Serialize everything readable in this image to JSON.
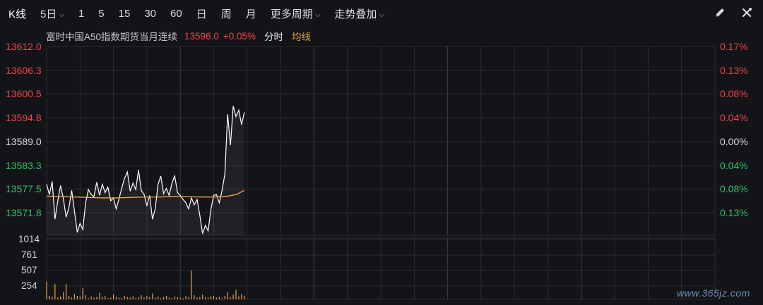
{
  "toolbar": {
    "items": [
      {
        "label": "K线"
      },
      {
        "label": "5日",
        "dropdown": true
      },
      {
        "label": "1"
      },
      {
        "label": "5"
      },
      {
        "label": "15"
      },
      {
        "label": "30"
      },
      {
        "label": "60"
      },
      {
        "label": "日"
      },
      {
        "label": "周"
      },
      {
        "label": "月"
      },
      {
        "label": "更多周期",
        "dropdown": true
      },
      {
        "label": "走势叠加",
        "dropdown": true
      }
    ],
    "tools": [
      "draw-pen-icon",
      "settings-cross-icon"
    ]
  },
  "info": {
    "title": "富时中国A50指数期货当月连续",
    "price": "13596.0",
    "change": "+0.05%",
    "mode": "分时",
    "avg_label": "均线"
  },
  "colors": {
    "up": "#f0444b",
    "down": "#2ec26b",
    "price_line": "#ffffff",
    "avg_line": "#e8a24a",
    "volume": "#e8a24a",
    "grid": "#2a2c31"
  },
  "watermark": "www.365jz.com",
  "chart_data": [
    {
      "type": "line",
      "title": "富时中国A50指数期货当月连续",
      "y_left_ticks": [
        "13612.0",
        "13606.3",
        "13600.5",
        "13594.8",
        "13589.0",
        "13583.3",
        "13577.5",
        "13571.8"
      ],
      "y_right_ticks": [
        "0.17%",
        "0.13%",
        "0.08%",
        "0.04%",
        "0.00%",
        "0.04%",
        "0.08%",
        "0.13%"
      ],
      "ylim": [
        13566.1,
        13612.0
      ],
      "reference_price": 13589.0,
      "x_range": [
        0,
        480
      ],
      "series": [
        {
          "name": "",
          "x": [
            0,
            2,
            4,
            6,
            8,
            10,
            12,
            14,
            16,
            18,
            20,
            22,
            24,
            26,
            28,
            30,
            32,
            34,
            36,
            38,
            40,
            42,
            44,
            46,
            48,
            50,
            52,
            54,
            56,
            58,
            60,
            62,
            64,
            66,
            68,
            70,
            72,
            74,
            76,
            78,
            80,
            82,
            84,
            86,
            88,
            90,
            92,
            94,
            96,
            98,
            100,
            102,
            104,
            106,
            108,
            110,
            112,
            114,
            116,
            118,
            120,
            122,
            124,
            126,
            128,
            130,
            132,
            134,
            136,
            138,
            140,
            142
          ],
          "values": [
            13578.5,
            13576.0,
            13579.2,
            13570.0,
            13574.5,
            13578.2,
            13575.0,
            13570.5,
            13572.8,
            13577.0,
            13572.0,
            13566.8,
            13569.0,
            13567.5,
            13574.0,
            13577.2,
            13576.0,
            13575.5,
            13579.0,
            13575.8,
            13578.5,
            13576.5,
            13577.8,
            13574.5,
            13575.2,
            13572.5,
            13575.0,
            13577.6,
            13580.0,
            13581.5,
            13576.8,
            13578.8,
            13577.2,
            13582.0,
            13577.0,
            13576.0,
            13573.2,
            13575.8,
            13570.0,
            13572.5,
            13578.5,
            13580.5,
            13576.2,
            13577.5,
            13575.8,
            13578.8,
            13580.5,
            13576.5,
            13575.8,
            13574.8,
            13574.0,
            13572.5,
            13575.2,
            13573.5,
            13574.8,
            13571.0,
            13566.5,
            13568.5,
            13567.2,
            13572.5,
            13575.8,
            13576.0,
            13574.0,
            13577.0,
            13581.0,
            13595.5,
            13588.0,
            13597.5,
            13595.0,
            13596.5,
            13593.0,
            13596.0
          ]
        },
        {
          "name": "均线",
          "x": [
            0,
            10,
            20,
            30,
            40,
            50,
            60,
            70,
            80,
            90,
            100,
            110,
            120,
            130,
            136,
            142
          ],
          "values": [
            13575.6,
            13575.5,
            13575.4,
            13575.3,
            13575.2,
            13575.2,
            13575.3,
            13575.4,
            13575.4,
            13575.5,
            13575.5,
            13575.4,
            13575.4,
            13575.6,
            13576.0,
            13577.0
          ]
        }
      ]
    },
    {
      "type": "bar",
      "title": "",
      "y_ticks": [
        "1014",
        "761",
        "507",
        "254"
      ],
      "ylim": [
        0,
        1014
      ],
      "x_range": [
        0,
        480
      ],
      "x": [
        0,
        2,
        4,
        6,
        8,
        10,
        12,
        14,
        16,
        18,
        20,
        22,
        24,
        26,
        28,
        30,
        32,
        34,
        36,
        38,
        40,
        42,
        44,
        46,
        48,
        50,
        52,
        54,
        56,
        58,
        60,
        62,
        64,
        66,
        68,
        70,
        72,
        74,
        76,
        78,
        80,
        82,
        84,
        86,
        88,
        90,
        92,
        94,
        96,
        98,
        100,
        102,
        104,
        106,
        108,
        110,
        112,
        114,
        116,
        118,
        120,
        122,
        124,
        126,
        128,
        130,
        132,
        134,
        136,
        138,
        140,
        142
      ],
      "values": [
        300,
        60,
        40,
        260,
        30,
        50,
        120,
        260,
        60,
        30,
        90,
        60,
        40,
        190,
        70,
        20,
        50,
        30,
        40,
        110,
        40,
        60,
        20,
        30,
        80,
        40,
        30,
        20,
        60,
        40,
        30,
        50,
        20,
        40,
        70,
        30,
        60,
        40,
        100,
        30,
        50,
        20,
        40,
        60,
        30,
        20,
        50,
        40,
        30,
        20,
        60,
        40,
        490,
        70,
        30,
        40,
        80,
        40,
        30,
        50,
        60,
        30,
        40,
        20,
        60,
        120,
        40,
        80,
        160,
        50,
        90,
        60
      ]
    }
  ]
}
